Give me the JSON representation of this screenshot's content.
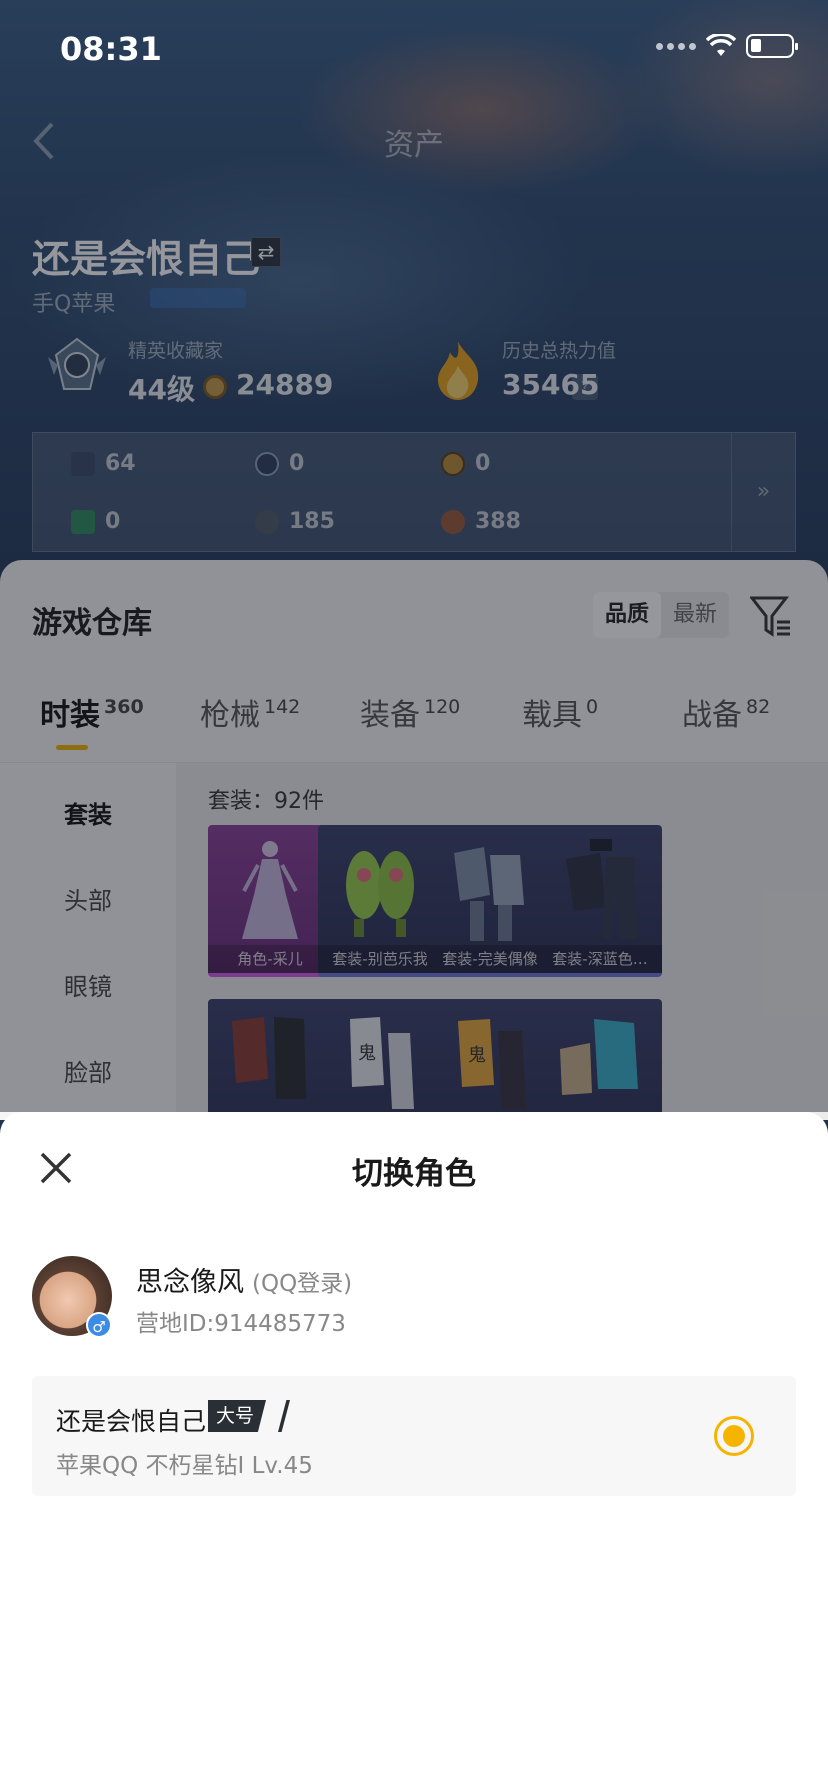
{
  "status_bar": {
    "time": "08:31"
  },
  "header": {
    "title": "资产"
  },
  "profile": {
    "role_name": "还是会恨自己",
    "platform": "手Q苹果",
    "collector_label": "精英收藏家",
    "collector_level": "44级",
    "coins": "24889",
    "heat_label": "历史总热力值",
    "heat_value": "35465",
    "help": "?"
  },
  "currencies": [
    {
      "value": "64",
      "color": "#3a4a6a"
    },
    {
      "value": "0",
      "color": "#2e3d5c"
    },
    {
      "value": "0",
      "color": "#b98a3a"
    },
    {
      "value": "0",
      "color": "#2f8c5e"
    },
    {
      "value": "185",
      "color": "#4f5a66"
    },
    {
      "value": "388",
      "color": "#9a5a3a"
    }
  ],
  "currency_expand": "»",
  "warehouse": {
    "title": "游戏仓库",
    "sort_options": [
      "品质",
      "最新"
    ],
    "tabs": [
      {
        "label": "时装",
        "count": "360"
      },
      {
        "label": "枪械",
        "count": "142"
      },
      {
        "label": "装备",
        "count": "120"
      },
      {
        "label": "载具",
        "count": "0"
      },
      {
        "label": "战备",
        "count": "82"
      }
    ],
    "sidebar": [
      "套装",
      "头部",
      "眼镜",
      "脸部"
    ],
    "suit_count": "套装：92件",
    "items_row1": [
      "角色-采儿",
      "套装-别芭乐我",
      "套装-完美偶像",
      "套装-深蓝色…"
    ],
    "items_row2": [
      "",
      "",
      "",
      ""
    ]
  },
  "sheet": {
    "title": "切换角色",
    "account_name": "思念像风",
    "login_type": "(QQ登录)",
    "camp_id": "营地ID:914485773",
    "gender_symbol": "♂",
    "role": {
      "name": "还是会恨自己",
      "tag": "大号",
      "info": "苹果QQ   不朽星钻I   Lv.45"
    }
  },
  "colors": {
    "accent": "#f5b400",
    "sheet_bg": "#ffffff"
  }
}
